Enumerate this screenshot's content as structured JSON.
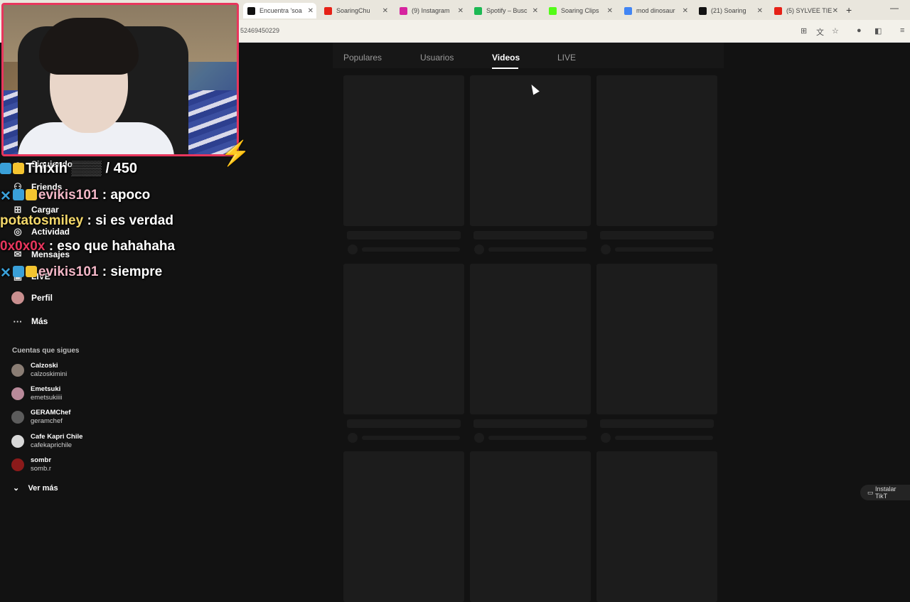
{
  "browser": {
    "tabs": [
      {
        "label": "Encuentra 'soa",
        "color": "#111111",
        "active": true
      },
      {
        "label": "SoaringChu",
        "color": "#e62117"
      },
      {
        "label": "(9) Instagram",
        "color": "#d6249f"
      },
      {
        "label": "Spotify – Busc",
        "color": "#1db954"
      },
      {
        "label": "Soaring Clips",
        "color": "#53fc18"
      },
      {
        "label": "mod dinosaur",
        "color": "#4285f4"
      },
      {
        "label": "(21) Soaring",
        "color": "#111111"
      },
      {
        "label": "(5) SYLVEE TIE",
        "color": "#e62117"
      }
    ],
    "new_tab": "+",
    "minimize": "—",
    "url": "52469450229"
  },
  "search_tabs": [
    "Populares",
    "Usuarios",
    "Videos",
    "LIVE"
  ],
  "active_search_tab": "Videos",
  "sidebar": {
    "items": [
      {
        "label": "Siguiendo",
        "icon": "following-icon"
      },
      {
        "label": "Friends",
        "icon": "friends-icon"
      },
      {
        "label": "Cargar",
        "icon": "upload-icon"
      },
      {
        "label": "Actividad",
        "icon": "activity-icon"
      },
      {
        "label": "Mensajes",
        "icon": "messages-icon"
      },
      {
        "label": "LIVE",
        "icon": "live-icon"
      },
      {
        "label": "Perfil",
        "icon": "profile-icon"
      },
      {
        "label": "Más",
        "icon": "more-icon"
      }
    ],
    "follow_title": "Cuentas que sigues",
    "following": [
      {
        "name": "Calzoski",
        "handle": "calzoskimini",
        "color": "#8a7d74"
      },
      {
        "name": "Emetsuki",
        "handle": "emetsukiiii",
        "color": "#b98a9a"
      },
      {
        "name": "GERAMChef",
        "handle": "geramchef",
        "color": "#5c5c5c"
      },
      {
        "name": "Cafe Kapri Chile",
        "handle": "cafekaprichile",
        "color": "#d8d8d8"
      },
      {
        "name": "sombr",
        "handle": "somb.r",
        "color": "#8b1a1a"
      }
    ],
    "ver_mas": "Ver más"
  },
  "overlay": {
    "goal_user": "Thixih",
    "goal_count": "/ 450",
    "chat": [
      {
        "user": "evikis101",
        "msg": ": apoco",
        "style": "pink",
        "badges": true
      },
      {
        "user": "potatosmiley",
        "msg": ": si es verdad",
        "style": "yellow",
        "badges": false
      },
      {
        "user": "0x0x0x",
        "msg": ": eso que hahahaha",
        "style": "red",
        "badges": false
      },
      {
        "user": "evikis101",
        "msg": ": siempre",
        "style": "pink",
        "badges": true
      }
    ]
  },
  "install_button": "Instalar TikT"
}
